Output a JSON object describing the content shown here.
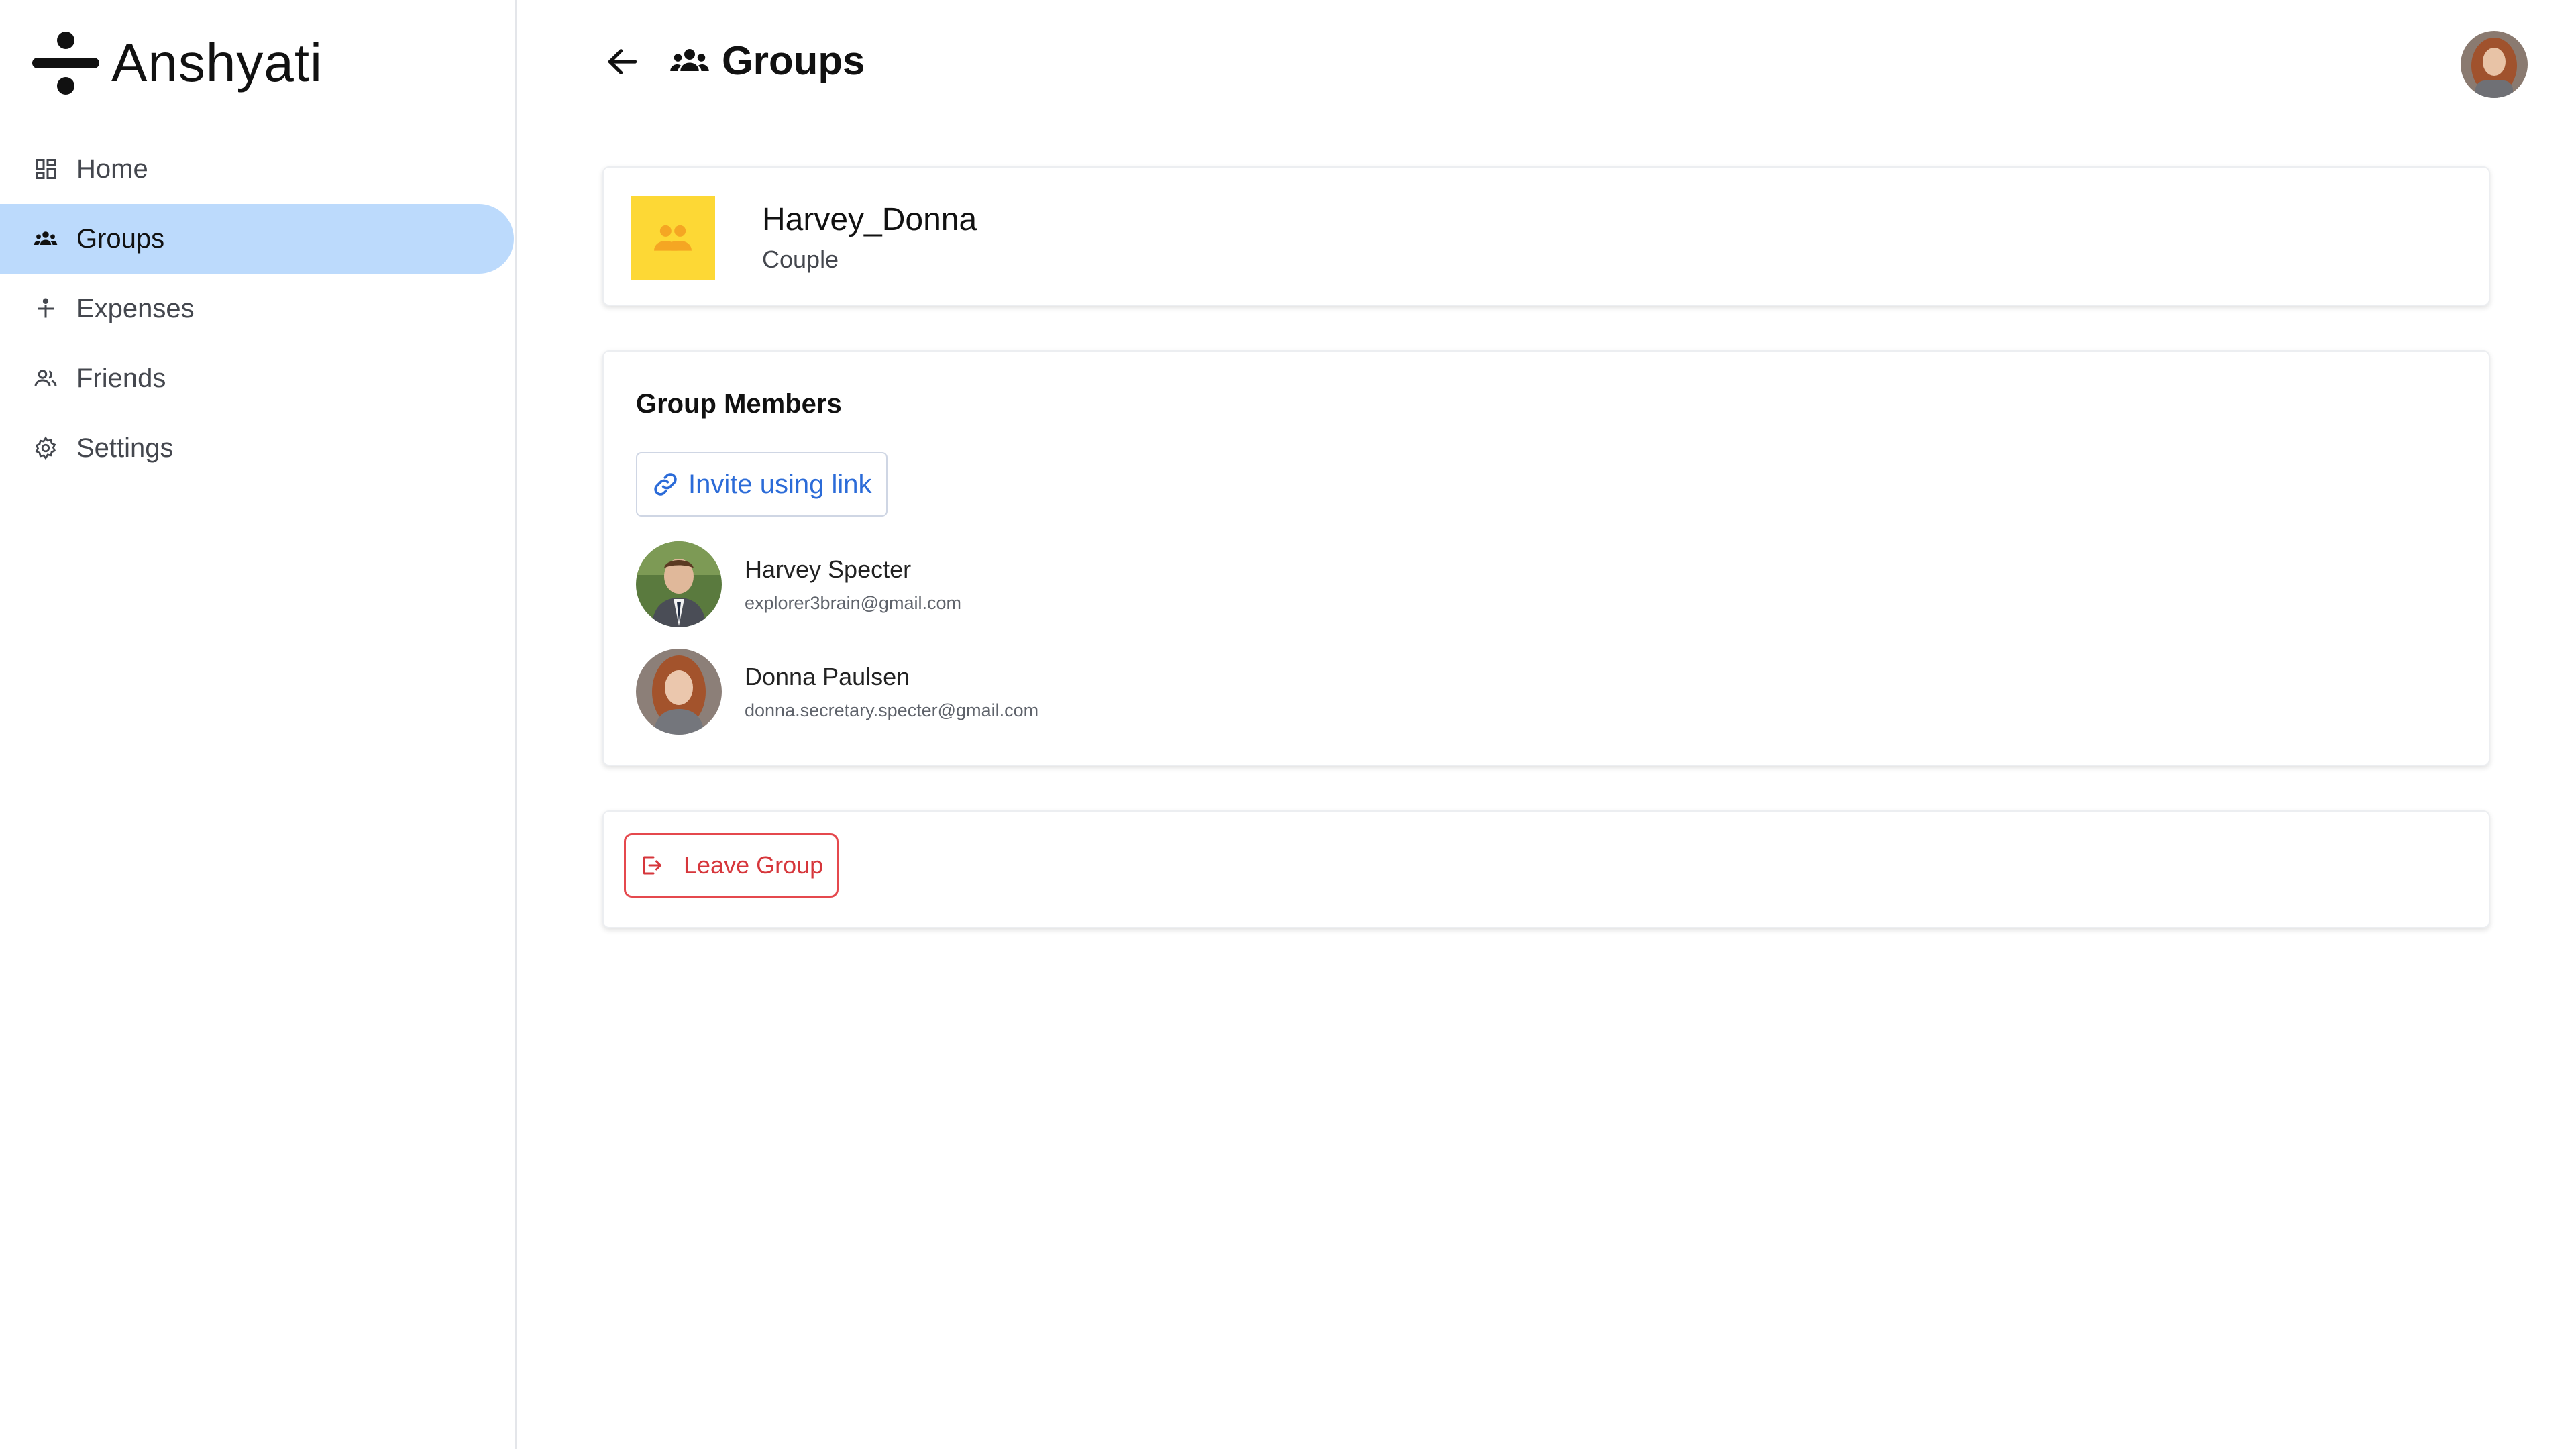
{
  "app": {
    "brand_name": "Anshyati",
    "brand_icon": "divide-icon"
  },
  "sidebar": {
    "items": [
      {
        "label": "Home",
        "icon": "dashboard-icon",
        "active": false
      },
      {
        "label": "Groups",
        "icon": "groups-icon",
        "active": true
      },
      {
        "label": "Expenses",
        "icon": "expense-icon",
        "active": false
      },
      {
        "label": "Friends",
        "icon": "friends-icon",
        "active": false
      },
      {
        "label": "Settings",
        "icon": "gear-icon",
        "active": false
      }
    ]
  },
  "header": {
    "title": "Groups",
    "back_icon": "arrow-left-icon",
    "title_icon": "groups-icon"
  },
  "group": {
    "name": "Harvey_Donna",
    "type": "Couple",
    "avatar_color": "#fdd835"
  },
  "members_section": {
    "title": "Group Members",
    "invite_label": "Invite using link",
    "members": [
      {
        "name": "Harvey Specter",
        "email": "explorer3brain@gmail.com"
      },
      {
        "name": "Donna Paulsen",
        "email": "donna.secretary.specter@gmail.com"
      }
    ]
  },
  "actions": {
    "leave_label": "Leave Group"
  },
  "colors": {
    "active_nav": "#bcdafc",
    "link_blue": "#2b6bd8",
    "danger_red": "#e5484d",
    "group_yellow": "#fdd835"
  }
}
